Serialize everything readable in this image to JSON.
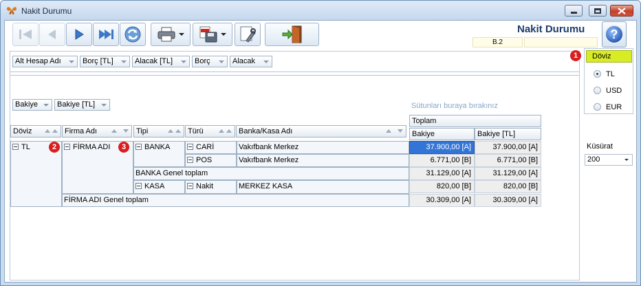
{
  "window": {
    "title": "Nakit Durumu"
  },
  "header": {
    "title": "Nakit Durumu",
    "code": "B.2",
    "code2": ""
  },
  "filter_fields": [
    "Alt Hesap Adı",
    "Borç [TL]",
    "Alacak [TL]",
    "Borç",
    "Alacak"
  ],
  "data_fields": [
    "Bakiye",
    "Bakiye [TL]"
  ],
  "drop_hint": "Sütunları buraya bırakınız",
  "row_headers": [
    "Döviz",
    "Firma Adı",
    "Tipi",
    "Türü",
    "Banka/Kasa Adı"
  ],
  "col_group": "Toplam",
  "col_values": [
    "Bakiye",
    "Bakiye [TL]"
  ],
  "rows": {
    "doviz": "TL",
    "firma": "FİRMA ADI",
    "tipi_banka": "BANKA",
    "turu_cari": "CARİ",
    "ad_cari": "Vakıfbank Merkez",
    "val_cari_1": "37.900,00 [A]",
    "val_cari_2": "37.900,00 [A]",
    "turu_pos": "POS",
    "ad_pos": "Vakıfbank Merkez",
    "val_pos_1": "6.771,00 [B]",
    "val_pos_2": "6.771,00 [B]",
    "banka_total_label": "BANKA Genel toplam",
    "val_banka_1": "31.129,00 [A]",
    "val_banka_2": "31.129,00 [A]",
    "tipi_kasa": "KASA",
    "turu_nakit": "Nakit",
    "ad_kasa": "MERKEZ KASA",
    "val_kasa_1": "820,00 [B]",
    "val_kasa_2": "820,00 [B]",
    "firma_total_label": "FİRMA ADI Genel toplam",
    "val_firma_1": "30.309,00 [A]",
    "val_firma_2": "30.309,00 [A]"
  },
  "badges": [
    "1",
    "2",
    "3"
  ],
  "currency_panel": {
    "title": "Döviz",
    "options": [
      "TL",
      "USD",
      "EUR"
    ],
    "selected": "TL"
  },
  "kusurat": {
    "label": "Küsürat",
    "value": "200"
  },
  "toolbar_icons": [
    "first-icon",
    "prev-icon",
    "next-icon",
    "last-icon",
    "refresh-icon",
    "print-icon",
    "pdf-save-icon",
    "settings-icon",
    "exit-icon"
  ]
}
